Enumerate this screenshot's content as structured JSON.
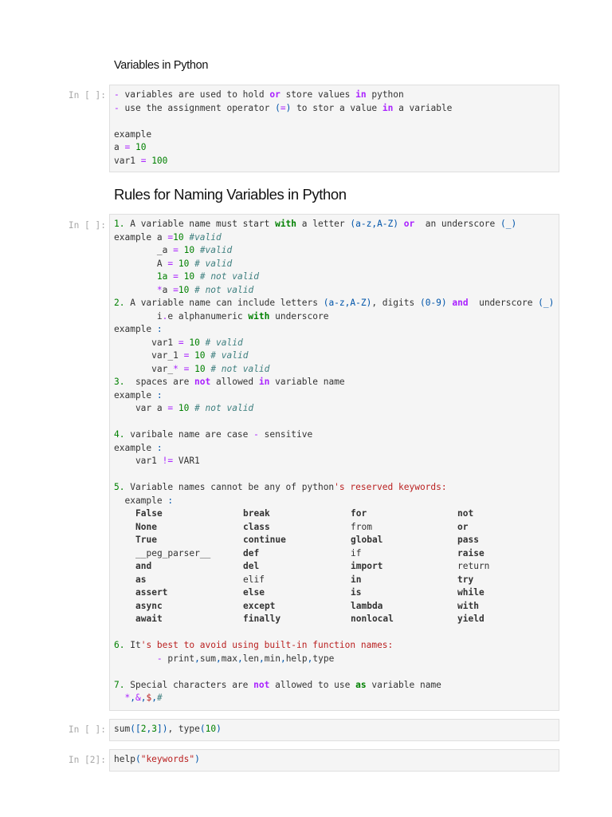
{
  "headings": {
    "h1": "Variables in Python",
    "h2": "Rules for Naming Variables in Python"
  },
  "colors": {
    "keyword": "#008000",
    "operator": "#aa22ff",
    "comment": "#408080",
    "bracket": "#0055aa",
    "string": "#ba2121",
    "cell_bg": "#f5f5f5"
  },
  "cells": [
    {
      "prompt": "In [ ]:",
      "lines": [
        [
          [
            "-",
            "o"
          ],
          [
            " variables are used to hold ",
            ""
          ],
          [
            "or",
            "p"
          ],
          [
            " store values ",
            ""
          ],
          [
            "in",
            "p"
          ],
          [
            " python",
            ""
          ]
        ],
        [
          [
            "-",
            "o"
          ],
          [
            " use the assignment operator ",
            ""
          ],
          [
            "(",
            "b"
          ],
          [
            "=",
            "o"
          ],
          [
            ")",
            "b"
          ],
          [
            " to stor a value ",
            ""
          ],
          [
            "in",
            "p"
          ],
          [
            " a variable",
            ""
          ]
        ],
        [],
        [
          [
            "example",
            ""
          ]
        ],
        [
          [
            "a ",
            ""
          ],
          [
            "=",
            "o"
          ],
          [
            " ",
            ""
          ],
          [
            "10",
            "n"
          ]
        ],
        [
          [
            "var1 ",
            ""
          ],
          [
            "=",
            "o"
          ],
          [
            " ",
            ""
          ],
          [
            "100",
            "n"
          ]
        ]
      ]
    },
    {
      "prompt": "In [ ]:",
      "grid_after_line": 22,
      "lines": [
        [
          [
            "1.",
            "n"
          ],
          [
            " A variable name must start ",
            ""
          ],
          [
            "with",
            "k"
          ],
          [
            " a letter ",
            ""
          ],
          [
            "(a-z,A-Z)",
            "b"
          ],
          [
            " ",
            ""
          ],
          [
            "or",
            "p"
          ],
          [
            "  an underscore ",
            ""
          ],
          [
            "(_)",
            "b"
          ]
        ],
        [
          [
            "example a ",
            ""
          ],
          [
            "=",
            "o"
          ],
          [
            "10",
            "n"
          ],
          [
            " #valid",
            "c"
          ]
        ],
        [
          [
            "        _a ",
            ""
          ],
          [
            "=",
            "o"
          ],
          [
            " ",
            ""
          ],
          [
            "10",
            "n"
          ],
          [
            " #valid",
            "c"
          ]
        ],
        [
          [
            "        A ",
            ""
          ],
          [
            "=",
            "o"
          ],
          [
            " ",
            ""
          ],
          [
            "10",
            "n"
          ],
          [
            " # valid",
            "c"
          ]
        ],
        [
          [
            "        ",
            ""
          ],
          [
            "1a",
            "n"
          ],
          [
            " ",
            ""
          ],
          [
            "=",
            "o"
          ],
          [
            " ",
            ""
          ],
          [
            "10",
            "n"
          ],
          [
            " # not valid",
            "c"
          ]
        ],
        [
          [
            "        ",
            ""
          ],
          [
            "*",
            "o"
          ],
          [
            "a ",
            ""
          ],
          [
            "=",
            "o"
          ],
          [
            "10",
            "n"
          ],
          [
            " # not valid",
            "c"
          ]
        ],
        [
          [
            "2.",
            "n"
          ],
          [
            " A variable name can include letters ",
            ""
          ],
          [
            "(a-z,A-Z)",
            "b"
          ],
          [
            ", digits ",
            ""
          ],
          [
            "(0-9)",
            "b"
          ],
          [
            " ",
            ""
          ],
          [
            "and",
            "p"
          ],
          [
            "  underscore ",
            ""
          ],
          [
            "(_)",
            "b"
          ]
        ],
        [
          [
            "        i",
            ""
          ],
          [
            ".",
            "o"
          ],
          [
            "e alphanumeric ",
            ""
          ],
          [
            "with",
            "k"
          ],
          [
            " underscore",
            ""
          ]
        ],
        [
          [
            "example ",
            ""
          ],
          [
            ":",
            "b"
          ]
        ],
        [
          [
            "       var1 ",
            ""
          ],
          [
            "=",
            "o"
          ],
          [
            " ",
            ""
          ],
          [
            "10",
            "n"
          ],
          [
            " # valid",
            "c"
          ]
        ],
        [
          [
            "       var_1 ",
            ""
          ],
          [
            "=",
            "o"
          ],
          [
            " ",
            ""
          ],
          [
            "10",
            "n"
          ],
          [
            " # valid",
            "c"
          ]
        ],
        [
          [
            "       var_",
            ""
          ],
          [
            "*",
            "o"
          ],
          [
            " ",
            ""
          ],
          [
            "=",
            "o"
          ],
          [
            " ",
            ""
          ],
          [
            "10",
            "n"
          ],
          [
            " # not valid",
            "c"
          ]
        ],
        [
          [
            "3.",
            "n"
          ],
          [
            "  spaces are ",
            ""
          ],
          [
            "not",
            "p"
          ],
          [
            " allowed ",
            ""
          ],
          [
            "in",
            "p"
          ],
          [
            " variable name",
            ""
          ]
        ],
        [
          [
            "example ",
            ""
          ],
          [
            ":",
            "b"
          ]
        ],
        [
          [
            "    var a ",
            ""
          ],
          [
            "=",
            "o"
          ],
          [
            " ",
            ""
          ],
          [
            "10",
            "n"
          ],
          [
            " # not valid",
            "c"
          ]
        ],
        [],
        [
          [
            "4.",
            "n"
          ],
          [
            " varibale name are case ",
            ""
          ],
          [
            "-",
            "o"
          ],
          [
            " sensitive",
            ""
          ]
        ],
        [
          [
            "example ",
            ""
          ],
          [
            ":",
            "b"
          ]
        ],
        [
          [
            "    var1 ",
            ""
          ],
          [
            "!=",
            "o"
          ],
          [
            " VAR1",
            ""
          ]
        ],
        [],
        [
          [
            "5.",
            "n"
          ],
          [
            " Variable names cannot be any of python",
            ""
          ],
          [
            "'s reserved keywords:",
            "s"
          ]
        ],
        [
          [
            "  example ",
            ""
          ],
          [
            ":",
            "b"
          ]
        ],
        [],
        [
          [
            "6.",
            "n"
          ],
          [
            " It",
            ""
          ],
          [
            "'s best to avoid using built-in function names:",
            "s"
          ]
        ],
        [
          [
            "        ",
            ""
          ],
          [
            "-",
            "o"
          ],
          [
            " print",
            ""
          ],
          [
            ",",
            "b"
          ],
          [
            "sum",
            ""
          ],
          [
            ",",
            "b"
          ],
          [
            "max",
            ""
          ],
          [
            ",",
            "b"
          ],
          [
            "len",
            ""
          ],
          [
            ",",
            "b"
          ],
          [
            "min",
            ""
          ],
          [
            ",",
            "b"
          ],
          [
            "help",
            ""
          ],
          [
            ",",
            "b"
          ],
          [
            "type",
            ""
          ]
        ],
        [],
        [
          [
            "7.",
            "n"
          ],
          [
            " Special characters are ",
            ""
          ],
          [
            "not",
            "p"
          ],
          [
            " allowed to use ",
            ""
          ],
          [
            "as",
            "k"
          ],
          [
            " variable name",
            ""
          ]
        ],
        [
          [
            "  ",
            ""
          ],
          [
            "*",
            "o"
          ],
          [
            ",",
            "b"
          ],
          [
            "&",
            "o"
          ],
          [
            ",",
            "b"
          ],
          [
            "$",
            "s"
          ],
          [
            ",",
            "b"
          ],
          [
            "#",
            "c"
          ]
        ]
      ],
      "keywords": [
        [
          [
            "False",
            "k"
          ],
          [
            "break",
            "k"
          ],
          [
            "for",
            "k"
          ],
          [
            "not",
            "p"
          ]
        ],
        [
          [
            "None",
            "k"
          ],
          [
            "class",
            "k"
          ],
          [
            "from",
            ""
          ],
          [
            "or",
            "p"
          ]
        ],
        [
          [
            "True",
            "k"
          ],
          [
            "continue",
            "k"
          ],
          [
            "global",
            "k"
          ],
          [
            "pass",
            "k"
          ]
        ],
        [
          [
            "__peg_parser__",
            ""
          ],
          [
            "def",
            "k"
          ],
          [
            "if",
            ""
          ],
          [
            "raise",
            "k"
          ]
        ],
        [
          [
            "and",
            "p"
          ],
          [
            "del",
            "k"
          ],
          [
            "import",
            "k"
          ],
          [
            "return",
            ""
          ]
        ],
        [
          [
            "as",
            "k"
          ],
          [
            "elif",
            ""
          ],
          [
            "in",
            "p"
          ],
          [
            "try",
            "k"
          ]
        ],
        [
          [
            "assert",
            "k"
          ],
          [
            "else",
            "k"
          ],
          [
            "is",
            "p"
          ],
          [
            "while",
            "k"
          ]
        ],
        [
          [
            "async",
            "k"
          ],
          [
            "except",
            "k"
          ],
          [
            "lambda",
            "k"
          ],
          [
            "with",
            "k"
          ]
        ],
        [
          [
            "await",
            "k"
          ],
          [
            "finally",
            "k"
          ],
          [
            "nonlocal",
            "k"
          ],
          [
            "yield",
            "k"
          ]
        ]
      ]
    },
    {
      "prompt": "In [ ]:",
      "lines": [
        [
          [
            "sum",
            ""
          ],
          [
            "([",
            "b"
          ],
          [
            "2",
            "n"
          ],
          [
            ",",
            "b"
          ],
          [
            "3",
            "n"
          ],
          [
            "])",
            "b"
          ],
          [
            ", type",
            ""
          ],
          [
            "(",
            "b"
          ],
          [
            "10",
            "n"
          ],
          [
            ")",
            "b"
          ]
        ]
      ]
    },
    {
      "prompt": "In [2]:",
      "lines": [
        [
          [
            "help",
            ""
          ],
          [
            "(",
            "b"
          ],
          [
            "\"keywords\"",
            "s"
          ],
          [
            ")",
            "b"
          ]
        ]
      ]
    }
  ]
}
